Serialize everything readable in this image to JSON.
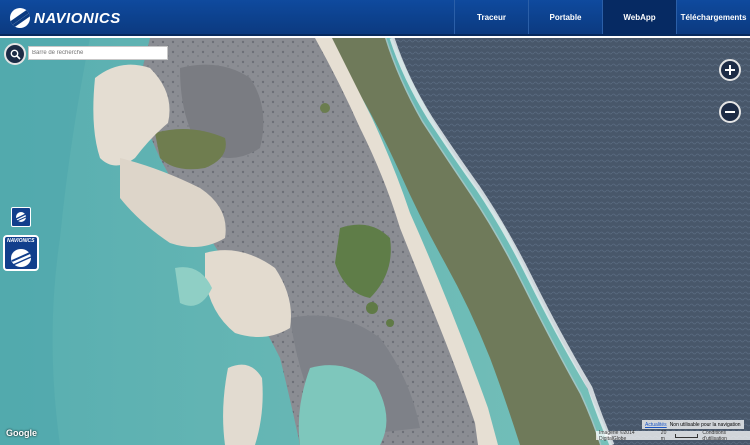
{
  "header": {
    "logo_text": "NAVIONICS",
    "nav": [
      {
        "label": "Traceur",
        "active": false
      },
      {
        "label": "Portable",
        "active": false
      },
      {
        "label": "WebApp",
        "active": true
      },
      {
        "label": "Téléchargements",
        "active": false
      }
    ]
  },
  "search": {
    "placeholder": "Barre de recherche"
  },
  "zoom": {
    "in_label": "+",
    "out_label": "−"
  },
  "badges": {
    "big_label": "NAVIONICS"
  },
  "footer": {
    "google": "Google",
    "updates_link": "Actualités",
    "nav_notice": "Non utilisable pour la navigation",
    "imagery": "Imagerie ©2014 DigitalGlobe",
    "scale": "20 m",
    "terms": "Conditions d'utilisation"
  },
  "colors": {
    "header_bg": "#0b3a80",
    "nav_active_bg": "#062a63",
    "lagoon": "#66b6b4",
    "ocean": "#4a5868",
    "sand": "#d9d3c9",
    "reef_gray": "#8a8c92"
  }
}
